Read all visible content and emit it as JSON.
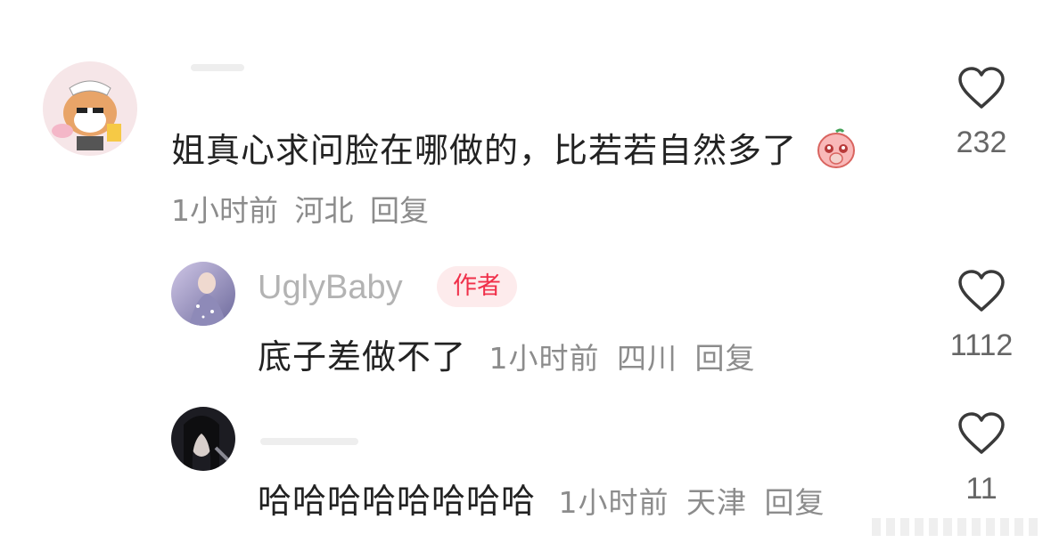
{
  "comments": [
    {
      "avatar": "cartoon-dog-maid-avatar",
      "text": "姐真心求问脸在哪做的，比若若自然多了",
      "emoji": "pleading-peach-emoji",
      "time": "1小时前",
      "location": "河北",
      "reply_label": "回复",
      "likes": "232"
    },
    {
      "avatar": "woman-photo-avatar",
      "username": "UglyBaby",
      "badge": "作者",
      "text": "底子差做不了",
      "time": "1小时前",
      "location": "四川",
      "reply_label": "回复",
      "likes": "1112"
    },
    {
      "avatar": "dark-portrait-avatar",
      "text": "哈哈哈哈哈哈哈哈",
      "time": "1小时前",
      "location": "天津",
      "reply_label": "回复",
      "likes": "11"
    }
  ],
  "icons": {
    "like": "heart-outline-icon"
  },
  "colors": {
    "badge_text": "#f0304a",
    "badge_bg": "#fdebec",
    "meta_text": "#8c8c8c",
    "username": "#b3b3b3"
  }
}
